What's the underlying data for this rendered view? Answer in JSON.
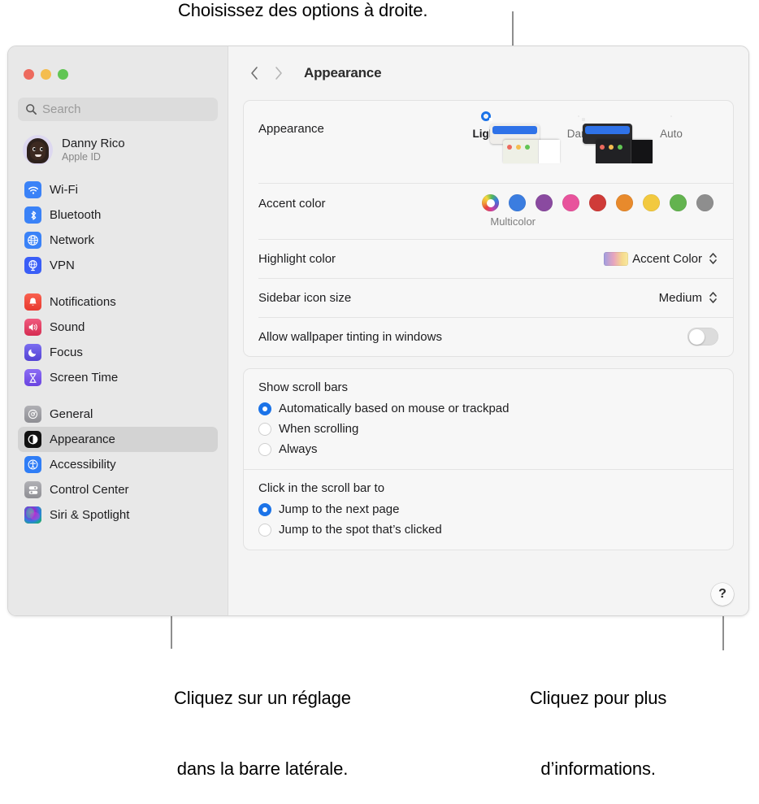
{
  "callouts": {
    "top": "Choisissez des options à droite.",
    "sidebar_line1": "Cliquez sur un réglage",
    "sidebar_line2": "dans la barre latérale.",
    "help_line1": "Cliquez pour plus",
    "help_line2": "d’informations."
  },
  "window": {
    "traffic_lights": [
      {
        "name": "close",
        "color": "#ed6a5e"
      },
      {
        "name": "minimize",
        "color": "#f4bd4f"
      },
      {
        "name": "zoom",
        "color": "#61c554"
      }
    ]
  },
  "sidebar": {
    "search": {
      "placeholder": "Search",
      "value": ""
    },
    "account": {
      "name": "Danny Rico",
      "subtitle": "Apple ID"
    },
    "groups": [
      {
        "items": [
          {
            "label": "Wi-Fi",
            "icon": "wifi-icon",
            "color": "#3a82f7"
          },
          {
            "label": "Bluetooth",
            "icon": "bluetooth-icon",
            "color": "#3a82f7"
          },
          {
            "label": "Network",
            "icon": "globe-icon",
            "color": "#3a82f7"
          },
          {
            "label": "VPN",
            "icon": "vpn-globe-icon",
            "color": "#3a5ef7"
          }
        ]
      },
      {
        "items": [
          {
            "label": "Notifications",
            "icon": "bell-icon",
            "color": "#f04a3c"
          },
          {
            "label": "Sound",
            "icon": "speaker-icon",
            "color": "#e8426b"
          },
          {
            "label": "Focus",
            "icon": "moon-icon",
            "color": "#6a5ae0"
          },
          {
            "label": "Screen Time",
            "icon": "hourglass-icon",
            "color": "#7a5ae8"
          }
        ]
      },
      {
        "items": [
          {
            "label": "General",
            "icon": "gear-icon",
            "color": "#9a9a9f"
          },
          {
            "label": "Appearance",
            "icon": "appearance-icon",
            "color": "#111111",
            "selected": true
          },
          {
            "label": "Accessibility",
            "icon": "accessibility-icon",
            "color": "#2f7df6"
          },
          {
            "label": "Control Center",
            "icon": "control-center-icon",
            "color": "#9a9a9f"
          },
          {
            "label": "Siri & Spotlight",
            "icon": "siri-icon",
            "color": "#2b2b6b"
          }
        ]
      }
    ]
  },
  "main": {
    "toolbar": {
      "back_icon": "chevron-left-icon",
      "forward_icon": "chevron-right-icon",
      "title": "Appearance"
    },
    "appearance": {
      "label": "Appearance",
      "options": [
        {
          "label": "Light",
          "selected": true
        },
        {
          "label": "Dark",
          "selected": false
        },
        {
          "label": "Auto",
          "selected": false
        }
      ]
    },
    "accent": {
      "label": "Accent color",
      "caption": "Multicolor",
      "swatches": [
        {
          "name": "Multicolor",
          "color": "multicolor",
          "selected": true
        },
        {
          "name": "Blue",
          "color": "#3b7de0"
        },
        {
          "name": "Purple",
          "color": "#8a4aa0"
        },
        {
          "name": "Pink",
          "color": "#e8539c"
        },
        {
          "name": "Red",
          "color": "#cf3b38"
        },
        {
          "name": "Orange",
          "color": "#e88a2c"
        },
        {
          "name": "Yellow",
          "color": "#f2c93f"
        },
        {
          "name": "Green",
          "color": "#63b martially"
        },
        {
          "name": "Graphite",
          "color": "#8e8e8e"
        }
      ]
    },
    "highlight": {
      "label": "Highlight color",
      "value": "Accent Color",
      "gradient": "accent-gradient"
    },
    "sidebar_icon_size": {
      "label": "Sidebar icon size",
      "value": "Medium"
    },
    "wallpaper_tinting": {
      "label": "Allow wallpaper tinting in windows",
      "enabled": false
    },
    "scroll_bars": {
      "title": "Show scroll bars",
      "options": [
        {
          "label": "Automatically based on mouse or trackpad",
          "selected": true
        },
        {
          "label": "When scrolling",
          "selected": false
        },
        {
          "label": "Always",
          "selected": false
        }
      ]
    },
    "scroll_click": {
      "title": "Click in the scroll bar to",
      "options": [
        {
          "label": "Jump to the next page",
          "selected": true
        },
        {
          "label": "Jump to the spot that’s clicked",
          "selected": false
        }
      ]
    },
    "help_button": {
      "label": "?"
    }
  }
}
